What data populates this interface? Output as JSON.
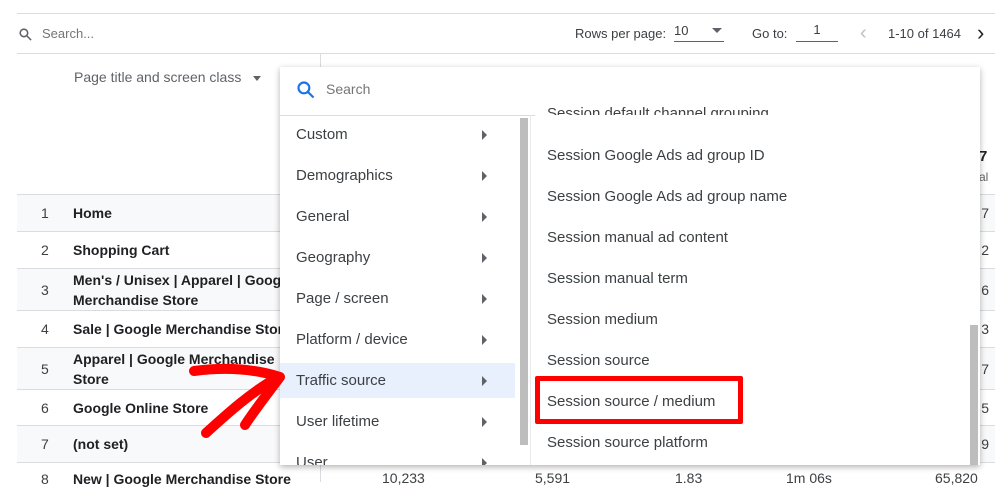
{
  "toolbar": {
    "search_placeholder": "Search...",
    "rows_per_page_label": "Rows per page:",
    "rows_per_page_value": "10",
    "goto_label": "Go to:",
    "goto_value": "1",
    "range": "1-10 of 1464"
  },
  "table": {
    "dimension_header": "Page title and screen class",
    "header_edge": "7",
    "header_edge_sub": "al",
    "rows": [
      {
        "n": "1",
        "title": "Home",
        "edge": "7"
      },
      {
        "n": "2",
        "title": "Shopping Cart",
        "edge": "2"
      },
      {
        "n": "3",
        "title": "Men's / Unisex | Apparel | Google Merchandise Store",
        "edge": "6"
      },
      {
        "n": "4",
        "title": "Sale | Google Merchandise Store",
        "edge": "3"
      },
      {
        "n": "5",
        "title": "Apparel | Google Merchandise Store",
        "edge": "7"
      },
      {
        "n": "6",
        "title": "Google Online Store",
        "edge": "5"
      },
      {
        "n": "7",
        "title": "(not set)",
        "edge": "9"
      },
      {
        "n": "8",
        "title": "New | Google Merchandise Store",
        "values": [
          "10,233",
          "5,591",
          "1.83",
          "1m 06s",
          "65,820"
        ]
      }
    ]
  },
  "menu": {
    "search_placeholder": "Search",
    "categories": [
      "Custom",
      "Demographics",
      "General",
      "Geography",
      "Page / screen",
      "Platform / device",
      "Traffic source",
      "User lifetime",
      "User"
    ],
    "active_category": "Traffic source",
    "options": [
      "Session default channel grouping",
      "Session Google Ads ad group ID",
      "Session Google Ads ad group name",
      "Session manual ad content",
      "Session manual term",
      "Session medium",
      "Session source",
      "Session source / medium",
      "Session source platform"
    ],
    "highlighted_option": "Session source / medium"
  },
  "colors": {
    "accent": "#1a73e8",
    "annotation": "#ff0000",
    "active_bg": "#e8f0fe"
  }
}
